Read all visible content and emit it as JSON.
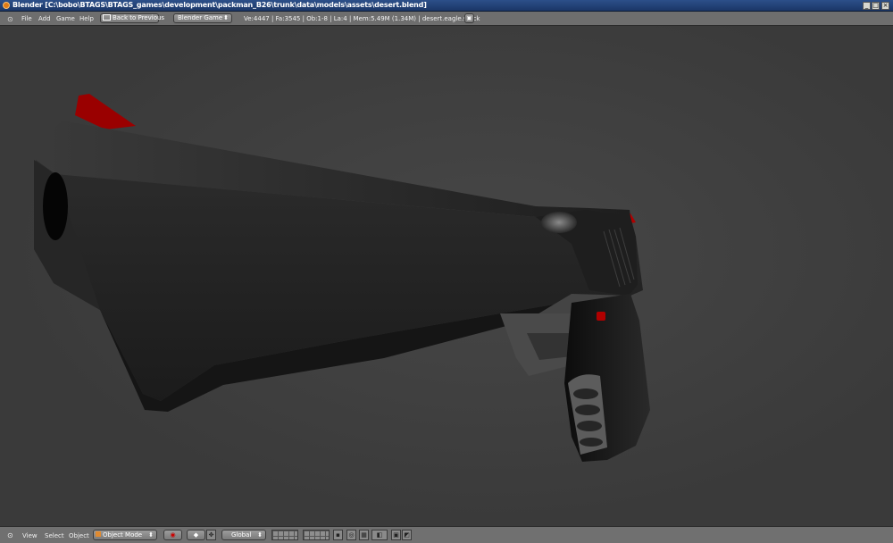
{
  "window": {
    "title": "Blender [C:\\bobo\\BTAGS\\BTAGS_games\\development\\packman_B26\\trunk\\data\\models\\assets\\desert.blend]",
    "controls": {
      "minimize": "_",
      "maximize": "□",
      "close": "×"
    }
  },
  "top_header": {
    "menus": [
      "File",
      "Add",
      "Game",
      "Help"
    ],
    "back_button": "Back to Previous",
    "engine": "Blender Game",
    "stats": "Ve:4447 | Fa:3545 | Ob:1-8 | La:4 | Mem:5.49M (1.34M) | desert.eagle.stack"
  },
  "viewport": {
    "object": "desert eagle pistol model",
    "background": "#3d3d3d"
  },
  "bottom_header": {
    "menus": [
      "View",
      "Select",
      "Object"
    ],
    "mode": "Object Mode",
    "orientation": "Global"
  },
  "colors": {
    "accent": "#cc0000",
    "header": "#6e6e6e",
    "title_bar": "#1f3a6e"
  }
}
